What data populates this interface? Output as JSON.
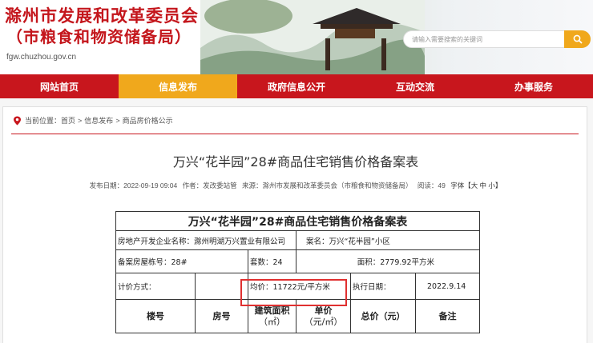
{
  "header": {
    "title_line1": "滁州市发展和改革委员会",
    "title_line2": "（市粮食和物资储备局）",
    "url": "fgw.chuzhou.gov.cn",
    "search_placeholder": "请输入需要搜索的关键词"
  },
  "nav": {
    "items": [
      {
        "label": "网站首页"
      },
      {
        "label": "信息发布"
      },
      {
        "label": "政府信息公开"
      },
      {
        "label": "互动交流"
      },
      {
        "label": "办事服务"
      }
    ]
  },
  "breadcrumb": {
    "prefix": "当前位置：",
    "items": [
      "首页",
      "信息发布",
      "商品房价格公示"
    ],
    "sep": ">"
  },
  "article": {
    "title": "万兴“花半园”28#商品住宅销售价格备案表",
    "date": "发布日期：2022-09-19 09:04",
    "author": "作者：发改委站管",
    "source": "来源：滁州市发展和改革委员会（市粮食和物资储备局）",
    "views": "阅读：49",
    "font_label": "字体【大 中 小】"
  },
  "table": {
    "caption": "万兴“花半园”28#商品住宅销售价格备案表",
    "developer": "房地产开发企业名称：滁州明湖万兴置业有限公司",
    "project": "案名：万兴“花半园”小区",
    "building": "备案房屋栋号：28#",
    "units": "套数：24",
    "area": "面积：2779.92平方米",
    "pricing_method": "计价方式：",
    "avg_price": "均价：11722元/平方米",
    "exec_date_label": "执行日期：",
    "exec_date": "2022.9.14",
    "headers": [
      "楼号",
      "房号",
      "建筑面积",
      "（㎡）",
      "单价",
      "（元/㎡）",
      "总价（元）",
      "备注"
    ]
  },
  "colors": {
    "brand_red": "#c8161d",
    "accent_orange": "#f0a81c",
    "highlight_red": "#e03030"
  }
}
